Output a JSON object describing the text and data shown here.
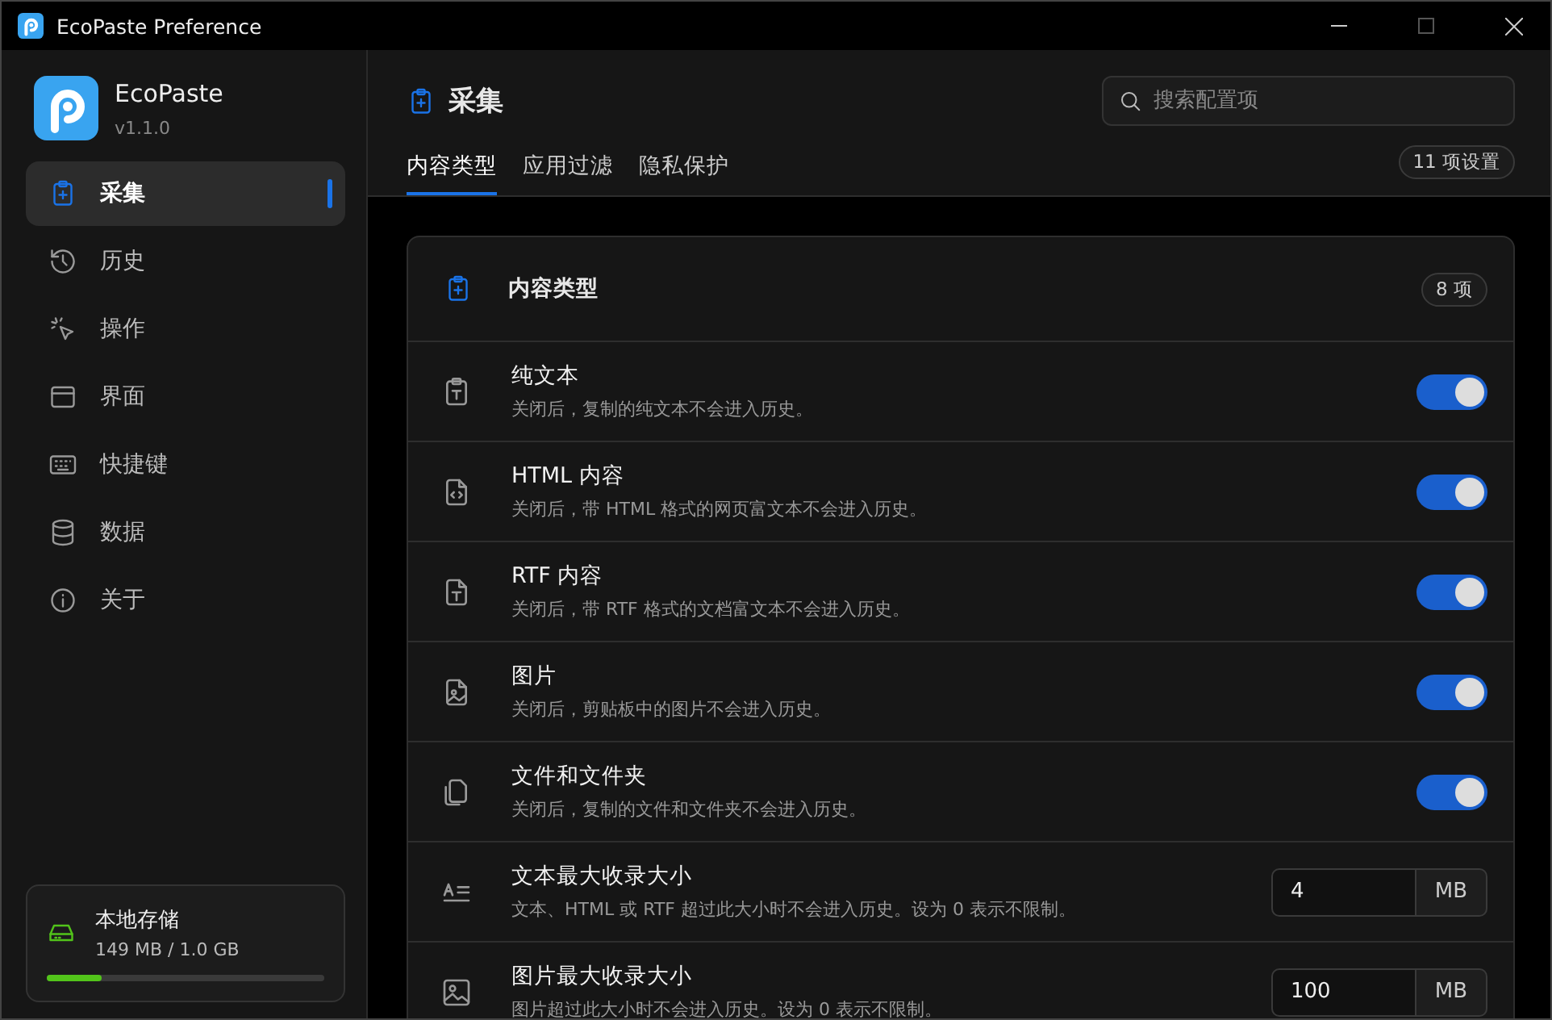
{
  "window": {
    "title": "EcoPaste Preference"
  },
  "app": {
    "name": "EcoPaste",
    "version": "v1.1.0"
  },
  "sidebar": {
    "items": [
      {
        "label": "采集",
        "selected": true
      },
      {
        "label": "历史",
        "selected": false
      },
      {
        "label": "操作",
        "selected": false
      },
      {
        "label": "界面",
        "selected": false
      },
      {
        "label": "快捷键",
        "selected": false
      },
      {
        "label": "数据",
        "selected": false
      },
      {
        "label": "关于",
        "selected": false
      }
    ],
    "storage": {
      "title": "本地存储",
      "usage": "149 MB / 1.0 GB",
      "level": 0.2
    }
  },
  "header": {
    "title": "采集",
    "search": {
      "placeholder": "搜索配置项"
    },
    "tabs": [
      {
        "label": "内容类型",
        "selected": true
      },
      {
        "label": "应用过滤",
        "selected": false
      },
      {
        "label": "隐私保护",
        "selected": false
      }
    ],
    "count": "11 项设置"
  },
  "card": {
    "title": "内容类型",
    "count": "8 项",
    "rows": [
      {
        "kind": "toggle",
        "title": "纯文本",
        "description": "关闭后，复制的纯文本不会进入历史。",
        "on": true
      },
      {
        "kind": "toggle",
        "title": "HTML 内容",
        "description": "关闭后，带 HTML 格式的网页富文本不会进入历史。",
        "on": true
      },
      {
        "kind": "toggle",
        "title": "RTF 内容",
        "description": "关闭后，带 RTF 格式的文档富文本不会进入历史。",
        "on": true
      },
      {
        "kind": "toggle",
        "title": "图片",
        "description": "关闭后，剪贴板中的图片不会进入历史。",
        "on": true
      },
      {
        "kind": "toggle",
        "title": "文件和文件夹",
        "description": "关闭后，复制的文件和文件夹不会进入历史。",
        "on": true
      },
      {
        "kind": "number",
        "title": "文本最大收录大小",
        "description": "文本、HTML 或 RTF 超过此大小时不会进入历史。设为 0 表示不限制。",
        "value": "4",
        "unit": "MB"
      },
      {
        "kind": "number",
        "title": "图片最大收录大小",
        "description": "图片超过此大小时不会进入历史。设为 0 表示不限制。",
        "value": "100",
        "unit": "MB"
      }
    ]
  }
}
